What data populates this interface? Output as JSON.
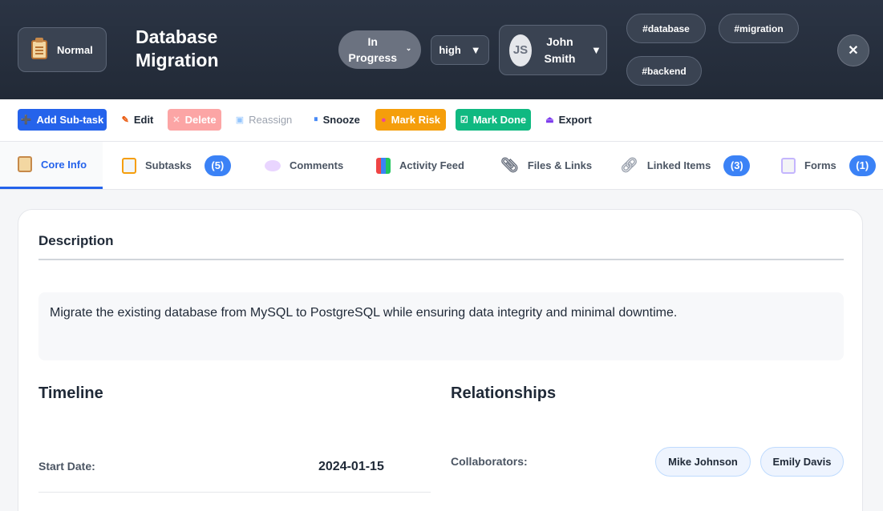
{
  "header": {
    "type_label": "Normal",
    "title": "Database Migration",
    "status": "In Progress",
    "priority": "high",
    "assignee": {
      "initials": "JS",
      "name": "John Smith"
    },
    "tags": [
      "#database",
      "#migration",
      "#backend"
    ],
    "close_glyph": "✕"
  },
  "toolbar": {
    "add_subtask": "Add Sub-task",
    "edit": "Edit",
    "delete": "Delete",
    "reassign": "Reassign",
    "snooze": "Snooze",
    "mark_risk": "Mark Risk",
    "mark_done": "Mark Done",
    "export": "Export"
  },
  "tabs": {
    "core_info": "Core Info",
    "subtasks": "Subtasks",
    "subtasks_count": "(5)",
    "comments": "Comments",
    "activity_feed": "Activity Feed",
    "files_links": "Files & Links",
    "linked_items": "Linked Items",
    "linked_items_count": "(3)",
    "forms": "Forms",
    "forms_count": "(1)"
  },
  "content": {
    "description_heading": "Description",
    "description_text": "Migrate the existing database from MySQL to PostgreSQL while ensuring data integrity and minimal downtime.",
    "timeline_heading": "Timeline",
    "start_date_label": "Start Date:",
    "start_date_value": "2024-01-15",
    "relationships_heading": "Relationships",
    "collaborators_label": "Collaborators:",
    "collaborators": [
      "Mike Johnson",
      "Emily Davis"
    ]
  },
  "colors": {
    "header_bg": "#2b3444",
    "accent": "#2563eb",
    "risk": "#f59e0b",
    "done": "#10b981",
    "delete": "#fca5a5"
  }
}
